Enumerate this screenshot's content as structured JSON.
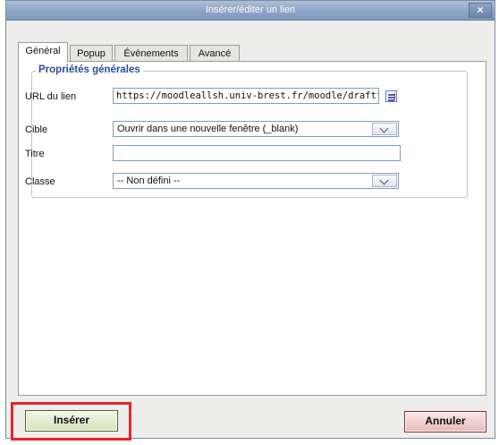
{
  "window": {
    "title": "Insérer/éditer un lien",
    "close_glyph": "×"
  },
  "tabs": [
    {
      "label": "Général",
      "active": true
    },
    {
      "label": "Popup",
      "active": false
    },
    {
      "label": "Événements",
      "active": false
    },
    {
      "label": "Avancé",
      "active": false
    }
  ],
  "general": {
    "legend": "Propriétés générales",
    "url_label": "URL du lien",
    "url_value": "https://moodleallsh.univ-brest.fr/moodle/draftfi",
    "target_label": "Cible",
    "target_value": "Ouvrir dans une nouvelle fenêtre (_blank)",
    "title_label": "Titre",
    "title_value": "",
    "class_label": "Classe",
    "class_value": "-- Non défini --"
  },
  "buttons": {
    "insert": "Insérer",
    "cancel": "Annuler"
  },
  "colors": {
    "highlight": "#e8232a",
    "legend": "#2b4a9b",
    "titlebar": "#8ea5c6"
  },
  "icons": {
    "browse": "browse-icon",
    "close": "close-icon"
  }
}
